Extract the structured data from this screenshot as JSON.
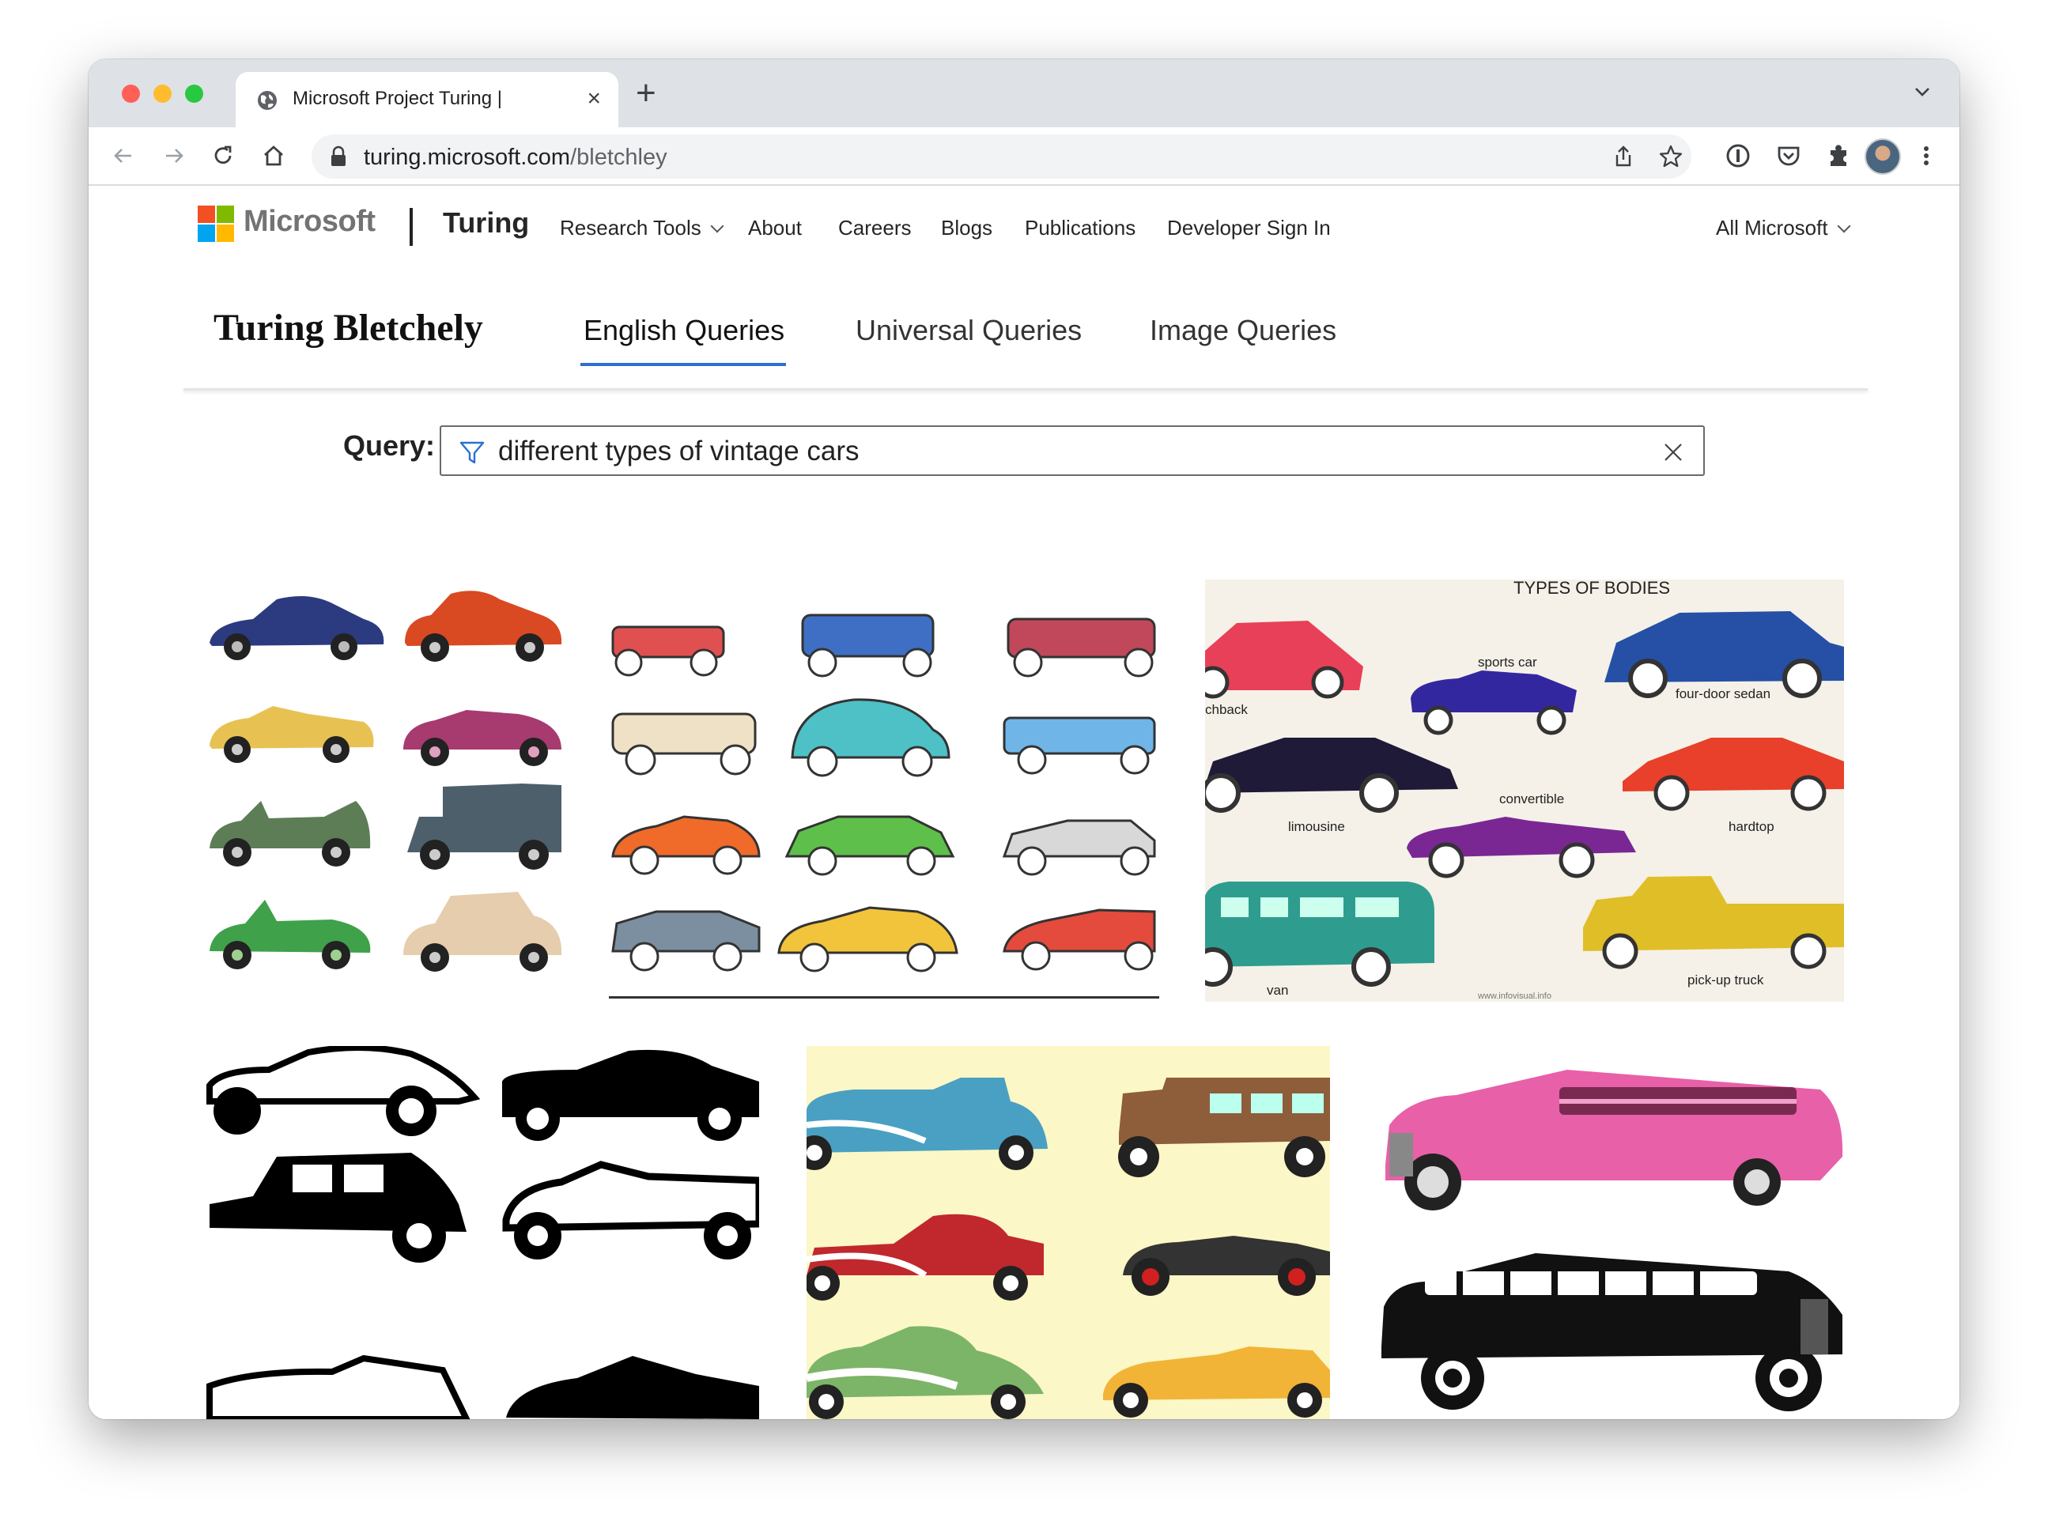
{
  "browser": {
    "tab_title": "Microsoft Project Turing |",
    "url_host": "turing.microsoft.com",
    "url_path": "/bletchley"
  },
  "nav": {
    "brand_microsoft": "Microsoft",
    "brand_turing": "Turing",
    "items": [
      "Research Tools",
      "About",
      "Careers",
      "Blogs",
      "Publications",
      "Developer Sign In"
    ],
    "all_microsoft": "All Microsoft"
  },
  "bletchley": {
    "title": "Turing Bletchely",
    "tabs": [
      "English Queries",
      "Universal Queries",
      "Image Queries"
    ],
    "active_tab": "English Queries"
  },
  "query": {
    "label": "Query:",
    "value": "different types of vintage cars"
  },
  "results": {
    "image3": {
      "heading": "TYPES OF BODIES",
      "labels": [
        "chback",
        "sports car",
        "four-door sedan",
        "limousine",
        "convertible",
        "hardtop",
        "van",
        "pick-up truck",
        "www.infovisual.info"
      ]
    }
  },
  "colors": {
    "accent": "#2b6fd1",
    "ms_red": "#f25022",
    "ms_green": "#7fba00",
    "ms_blue": "#00a4ef",
    "ms_yellow": "#ffb900"
  }
}
